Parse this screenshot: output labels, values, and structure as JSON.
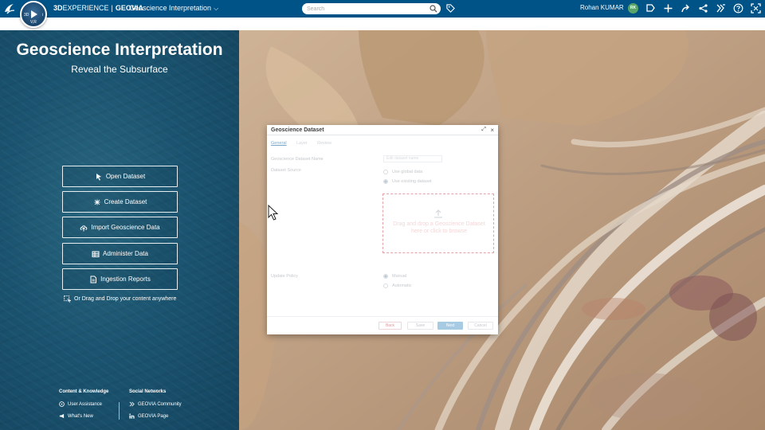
{
  "topbar": {
    "brand_bold": "3D",
    "brand_rest": "EXPERIENCE",
    "brand_company": "GEOVIA",
    "app_title": "Geoscience Interpretation",
    "compass_version": "V,R",
    "search_placeholder": "Search",
    "user_name": "Rohan KUMAR",
    "user_initials": "RK",
    "colors": {
      "bar": "#005386",
      "avatar": "#5aa469"
    }
  },
  "left_panel": {
    "title": "Geoscience Interpretation",
    "subtitle": "Reveal the Subsurface",
    "actions": [
      {
        "label": "Open Dataset",
        "icon": "open-icon"
      },
      {
        "label": "Create Dataset",
        "icon": "sparkle-icon"
      },
      {
        "label": "Import Geoscience Data",
        "icon": "cloud-upload-icon"
      },
      {
        "label": "Administer Data",
        "icon": "table-icon"
      },
      {
        "label": "Ingestion Reports",
        "icon": "document-icon"
      }
    ],
    "drop_note": "Or Drag and Drop your content anywhere",
    "footer": {
      "knowledge_heading": "Content & Knowledge",
      "knowledge_links": [
        "User Assistance",
        "What's New"
      ],
      "social_heading": "Social Networks",
      "social_links": [
        "GEOVIA Community",
        "GEOVIA Page"
      ]
    }
  },
  "dialog": {
    "title": "Geoscience Dataset",
    "tabs": [
      "General",
      "Layer",
      "Review"
    ],
    "dataset_name_label": "Geoscience Dataset Name",
    "dataset_name_placeholder": "Edit dataset name",
    "dataset_source_label": "Dataset Source",
    "source_options": [
      "Use global data",
      "Use existing dataset"
    ],
    "selected_source": "Use existing dataset",
    "drop_text": "Drag and drop a Geoscience Dataset here or click to browse",
    "update_policy_label": "Update Policy",
    "policy_options": [
      "Manual",
      "Automatic"
    ],
    "selected_policy": "Manual",
    "buttons": {
      "back": "Back",
      "save": "Save",
      "next": "Next",
      "cancel": "Cancel"
    }
  }
}
